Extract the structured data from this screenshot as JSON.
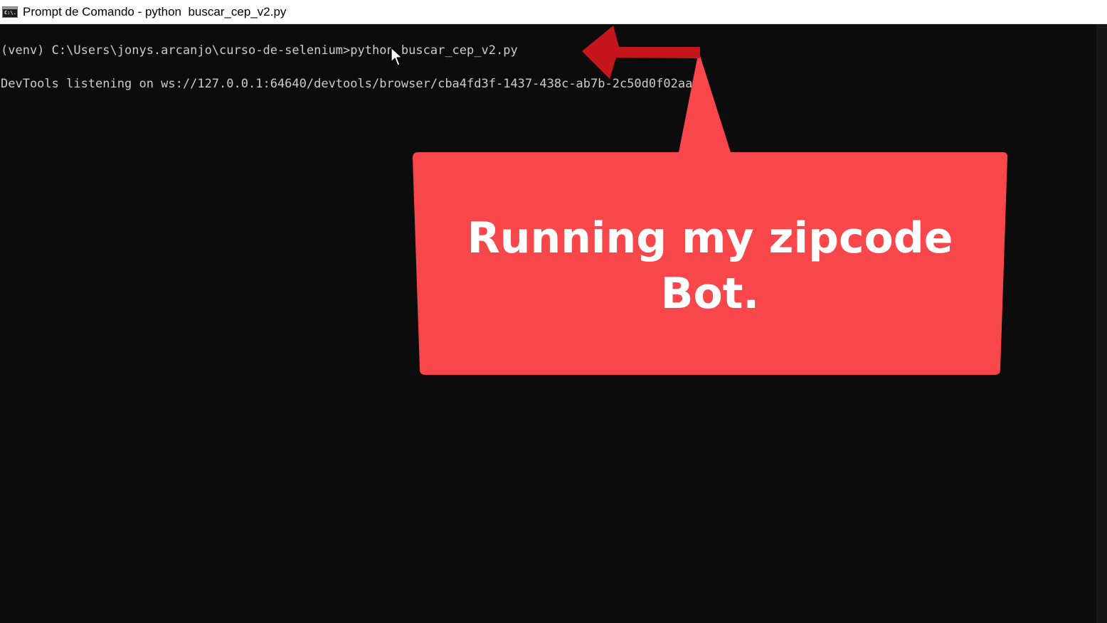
{
  "window": {
    "title": "Prompt de Comando - python  buscar_cep_v2.py",
    "icon_label": "C:\\."
  },
  "console": {
    "lines": [
      "(venv) C:\\Users\\jonys.arcanjo\\curso-de-selenium>python buscar_cep_v2.py",
      "DevTools listening on ws://127.0.0.1:64640/devtools/browser/cba4fd3f-1437-438c-ab7b-2c50d0f02aa4"
    ]
  },
  "annotation": {
    "line1": "Running my zipcode",
    "line2": "Bot.",
    "color": "#f7474a",
    "arrow_color": "#c4161c"
  },
  "colors": {
    "terminal_background": "#0c0c0c",
    "terminal_text": "#cccccc",
    "titlebar_background": "#ffffff"
  }
}
